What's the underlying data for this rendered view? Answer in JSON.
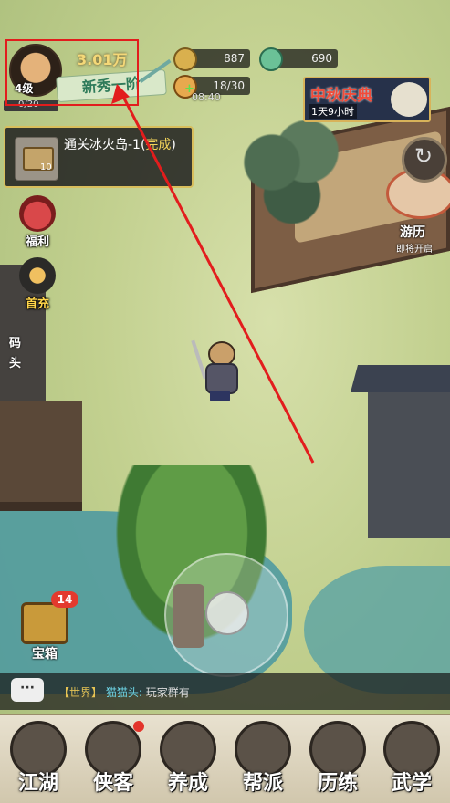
{
  "player": {
    "level": "4级",
    "power": "3.01万",
    "title": "新秀一阶",
    "exp": "0/20"
  },
  "resources": {
    "coins": "887",
    "jade": "690",
    "stamina": "18/30",
    "stamina_timer": "08:40"
  },
  "event_banner": {
    "title": "中秋庆典",
    "time_left": "1天9小时"
  },
  "quest": {
    "text": "通关冰火岛-1(",
    "status": "完成",
    "close": ")",
    "reward_count": "10"
  },
  "side_buttons": {
    "welfare": "福利",
    "first_recharge": "首充",
    "dock": "码头"
  },
  "travel": {
    "label": "游历",
    "sub": "即将开启"
  },
  "treasure": {
    "label": "宝箱",
    "badge": "14"
  },
  "chat": {
    "channel": "【世界】",
    "name": "猫猫头:",
    "message": "玩家群有"
  },
  "nav": [
    {
      "label": "江湖",
      "icon": "map-icon"
    },
    {
      "label": "侠客",
      "icon": "hero-icon"
    },
    {
      "label": "养成",
      "icon": "gourd-icon"
    },
    {
      "label": "帮派",
      "icon": "guild-icon"
    },
    {
      "label": "历练",
      "icon": "training-icon"
    },
    {
      "label": "武学",
      "icon": "scroll-icon"
    }
  ],
  "colors": {
    "highlight_box": "#e21d1d",
    "gold_text": "#f4d878",
    "badge_red": "#e33a2e"
  }
}
